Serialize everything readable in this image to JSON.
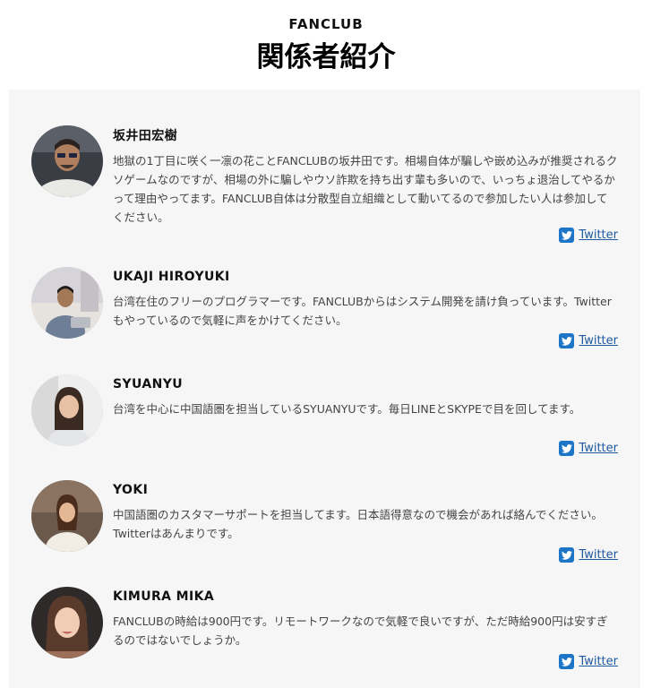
{
  "header": {
    "eyebrow": "FANCLUB",
    "title": "関係者紹介"
  },
  "colors": {
    "panel_bg": "#f6f6f6",
    "twitter_icon": "#1d75c8",
    "link": "#1f5aa0"
  },
  "members": [
    {
      "name": "坂井田宏樹",
      "bio": "地獄の1丁目に咲く一凛の花ことFANCLUBの坂井田です。相場自体が騙しや嵌め込みが推奨されるクソゲームなのですが、相場の外に騙しやウソ詐欺を持ち出す輩も多いので、いっちょ退治してやるかって理由やってます。FANCLUB自体は分散型自立組織として動いてるので参加したい人は参加してください。",
      "link_label": "Twitter",
      "icon": "twitter-icon"
    },
    {
      "name": "UKAJI HIROYUKI",
      "bio": "台湾在住のフリーのプログラマーです。FANCLUBからはシステム開発を請け負っています。Twitterもやっているので気軽に声をかけてください。",
      "link_label": "Twitter",
      "icon": "twitter-icon"
    },
    {
      "name": "SYUANYU",
      "bio": "台湾を中心に中国語圏を担当しているSYUANYUです。毎日LINEとSKYPEで目を回してます。",
      "link_label": "Twitter",
      "icon": "twitter-icon"
    },
    {
      "name": "YOKI",
      "bio": "中国語圏のカスタマーサポートを担当してます。日本語得意なので機会があれば絡んでください。Twitterはあんまりです。",
      "link_label": "Twitter",
      "icon": "twitter-icon"
    },
    {
      "name": "KIMURA MIKA",
      "bio": "FANCLUBの時給は900円です。リモートワークなので気軽で良いですが、ただ時給900円は安すぎるのではないでしょうか。",
      "link_label": "Twitter",
      "icon": "twitter-icon"
    }
  ]
}
